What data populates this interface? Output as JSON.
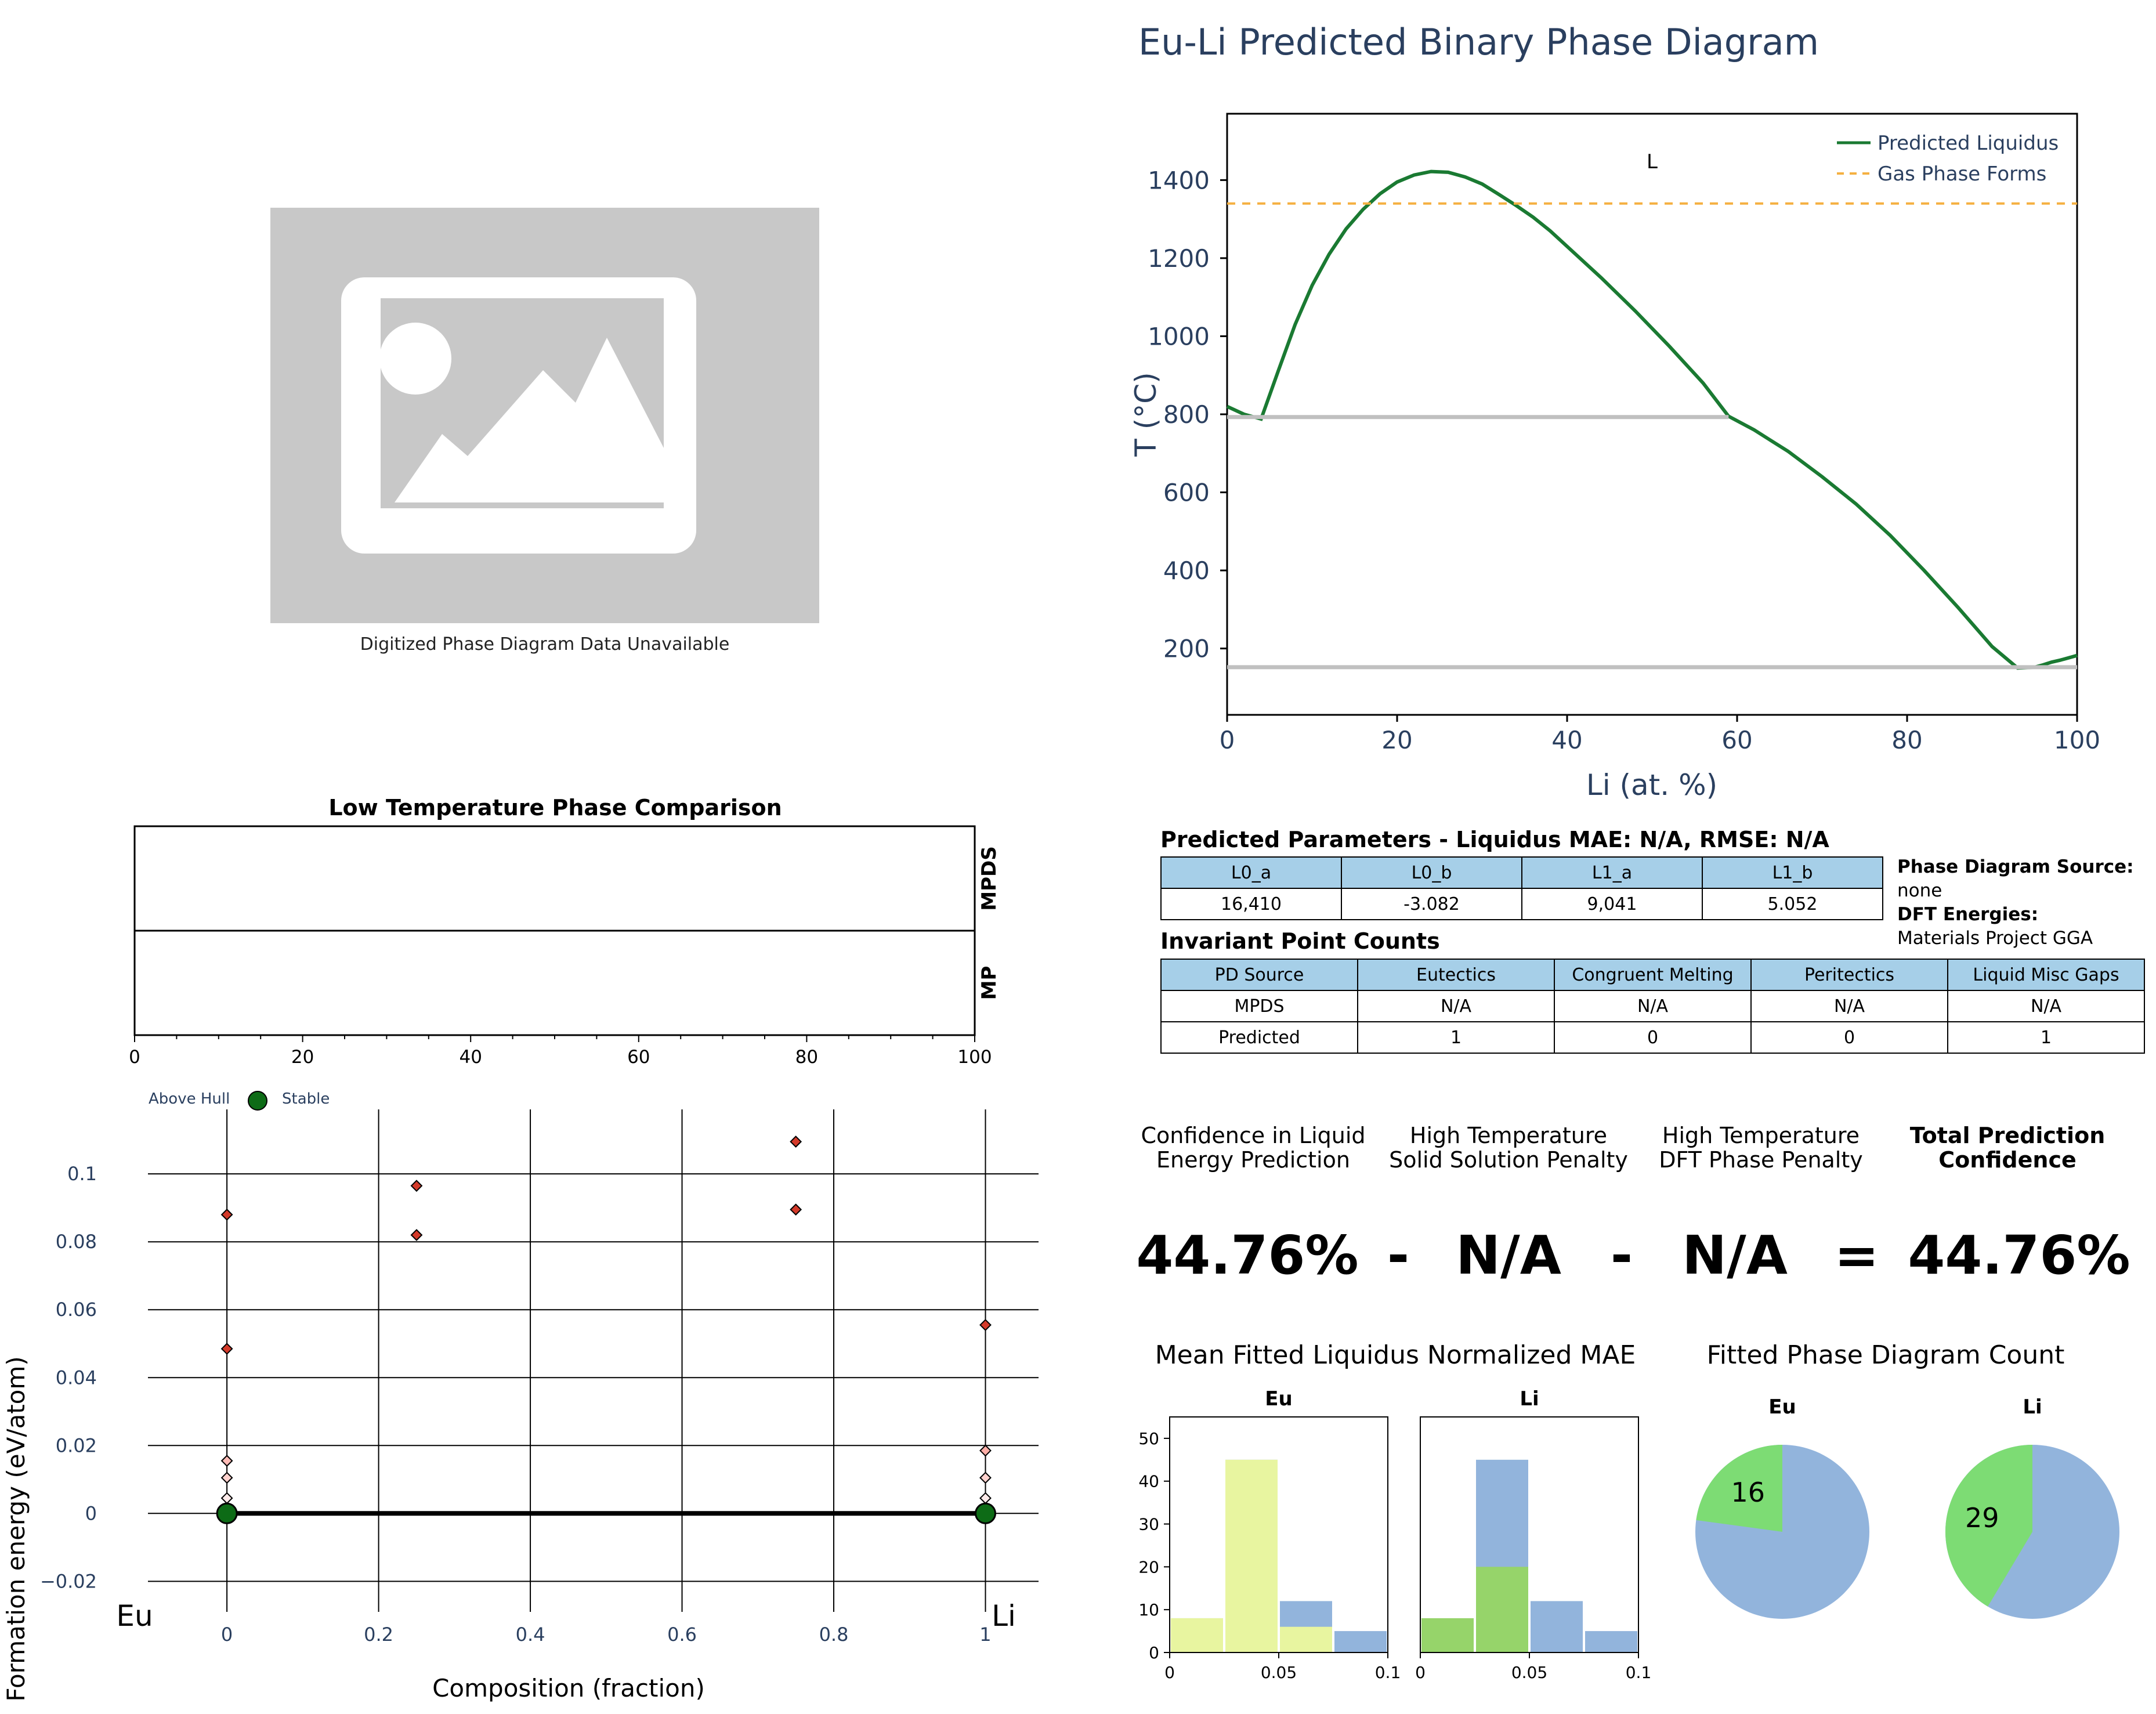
{
  "placeholder": {
    "caption": "Digitized Phase Diagram Data Unavailable",
    "icon": "image-placeholder-icon"
  },
  "phase_title": "Eu-Li Predicted Binary Phase Diagram",
  "low_temp": {
    "title": "Low Temperature Phase Comparison",
    "row_labels": [
      "MPDS",
      "MP"
    ],
    "x_ticks": [
      0,
      20,
      40,
      60,
      80,
      100
    ]
  },
  "params": {
    "title": "Predicted Parameters - Liquidus MAE: N/A, RMSE: N/A",
    "headers": [
      "L0_a",
      "L0_b",
      "L1_a",
      "L1_b"
    ],
    "values": [
      "16,410",
      "-3.082",
      "9,041",
      "5.052"
    ],
    "source_label": "Phase Diagram Source:",
    "source_value": "none",
    "dft_label": "DFT Energies:",
    "dft_value": "Materials Project GGA"
  },
  "invariants": {
    "title": "Invariant Point Counts",
    "headers": [
      "PD Source",
      "Eutectics",
      "Congruent Melting",
      "Peritectics",
      "Liquid Misc Gaps"
    ],
    "rows": [
      [
        "MPDS",
        "N/A",
        "N/A",
        "N/A",
        "N/A"
      ],
      [
        "Predicted",
        "1",
        "0",
        "0",
        "1"
      ]
    ]
  },
  "confidence": {
    "headers": [
      [
        "Confidence in Liquid",
        "Energy Prediction"
      ],
      [
        "High Temperature",
        "Solid Solution Penalty"
      ],
      [
        "High Temperature",
        "DFT Phase Penalty"
      ],
      [
        "Total Prediction",
        "Confidence"
      ]
    ],
    "values": [
      "44.76%",
      "N/A",
      "N/A",
      "44.76%"
    ],
    "operators": [
      "-",
      "-",
      "="
    ]
  },
  "colors": {
    "liquidus": "#1a7a32",
    "gas": "#f5b041",
    "invariant_line": "#c0c0c0",
    "stable": "#0d6b16",
    "above_hull": "#d43a2a",
    "hist_yellow": "#e8f5a0",
    "hist_blue": "#92b4dc",
    "hist_green": "#96d46a",
    "pie_green": "#7ddc74",
    "pie_blue": "#92b4dc",
    "header_blue": "#a6cfe8",
    "title_navy": "#2a3f5f"
  },
  "chart_data": [
    {
      "type": "line",
      "title": "Eu-Li Predicted Binary Phase Diagram",
      "xlabel": "Li (at. %)",
      "ylabel": "T (°C)",
      "xlim": [
        0,
        100
      ],
      "ylim": [
        30,
        1570
      ],
      "x_ticks": [
        0,
        20,
        40,
        60,
        80,
        100
      ],
      "y_ticks": [
        200,
        400,
        600,
        800,
        1000,
        1200,
        1400
      ],
      "legend_position": "top-right",
      "annotations": [
        {
          "text": "L",
          "x": 50,
          "y": 1430
        }
      ],
      "series": [
        {
          "name": "Predicted Liquidus",
          "style": "solid",
          "x": [
            0,
            2,
            4,
            6,
            8,
            10,
            12,
            14,
            16,
            18,
            20,
            22,
            24,
            26,
            28,
            30,
            32,
            34,
            36,
            38,
            40,
            44,
            48,
            52,
            56,
            59,
            62,
            66,
            70,
            74,
            78,
            82,
            86,
            90,
            93,
            95,
            96,
            97,
            98,
            100
          ],
          "y": [
            820,
            800,
            788,
            910,
            1030,
            1130,
            1210,
            1275,
            1325,
            1365,
            1395,
            1413,
            1422,
            1420,
            1408,
            1390,
            1363,
            1335,
            1305,
            1270,
            1230,
            1150,
            1065,
            975,
            880,
            795,
            760,
            705,
            640,
            570,
            490,
            400,
            305,
            205,
            150,
            152,
            158,
            165,
            170,
            182
          ]
        },
        {
          "name": "Gas Phase Forms",
          "style": "dashed",
          "x": [
            0,
            100
          ],
          "y": [
            1340,
            1340
          ]
        },
        {
          "name": "",
          "style": "invariant",
          "x": [
            0,
            59
          ],
          "y": [
            793,
            793
          ]
        },
        {
          "name": "",
          "style": "invariant",
          "x": [
            0,
            100
          ],
          "y": [
            152,
            152
          ]
        }
      ]
    },
    {
      "type": "scatter",
      "xlabel": "Composition (fraction)",
      "ylabel": "Formation energy (eV/atom)",
      "xlim": [
        -0.15,
        1.07
      ],
      "ylim": [
        -0.029,
        0.119
      ],
      "x_ticks": [
        0,
        0.2,
        0.4,
        0.6,
        0.8,
        1
      ],
      "x_tick_labels": [
        "0",
        "0.2",
        "0.4",
        "0.6",
        "0.8",
        "1"
      ],
      "y_ticks": [
        -0.02,
        0,
        0.02,
        0.04,
        0.06,
        0.08,
        0.1
      ],
      "y_tick_labels": [
        "−0.02",
        "0",
        "0.02",
        "0.04",
        "0.06",
        "0.08",
        "0.1"
      ],
      "end_labels": [
        "Eu",
        "Li"
      ],
      "legend": [
        "Above Hull",
        "Stable"
      ],
      "legend_position": "top-left",
      "hull_line": {
        "x": [
          0,
          1
        ],
        "y": [
          0,
          0
        ]
      },
      "stable_points": [
        {
          "x": 0,
          "y": 0
        },
        {
          "x": 1,
          "y": 0
        }
      ],
      "above_hull_points": [
        {
          "x": 0,
          "y": 0.088
        },
        {
          "x": 0,
          "y": 0.0485
        },
        {
          "x": 0,
          "y": 0.0155
        },
        {
          "x": 0,
          "y": 0.0105
        },
        {
          "x": 0,
          "y": 0.0045
        },
        {
          "x": 0.25,
          "y": 0.0965
        },
        {
          "x": 0.25,
          "y": 0.082
        },
        {
          "x": 0.75,
          "y": 0.1095
        },
        {
          "x": 0.75,
          "y": 0.0895
        },
        {
          "x": 1,
          "y": 0.0555
        },
        {
          "x": 1,
          "y": 0.0185
        },
        {
          "x": 1,
          "y": 0.0105
        },
        {
          "x": 1,
          "y": 0.0045
        },
        {
          "x": 1,
          "y": 0.0015
        }
      ]
    },
    {
      "type": "bar",
      "title": "Mean Fitted Liquidus Normalized MAE",
      "panels": [
        {
          "name": "Eu",
          "bins": [
            0,
            0.025,
            0.05,
            0.075,
            0.1
          ],
          "series": [
            {
              "name": "",
              "color": "#92b4dc",
              "values": [
                8,
                45,
                12,
                5
              ]
            },
            {
              "name": "",
              "color": "#e8f5a0",
              "values": [
                8,
                45,
                6,
                0
              ]
            }
          ]
        },
        {
          "name": "Li",
          "bins": [
            0,
            0.025,
            0.05,
            0.075,
            0.1
          ],
          "series": [
            {
              "name": "",
              "color": "#92b4dc",
              "values": [
                8,
                45,
                12,
                5
              ]
            },
            {
              "name": "",
              "color": "#96d46a",
              "values": [
                8,
                20,
                0,
                0
              ]
            }
          ]
        }
      ],
      "ylim": [
        0,
        55
      ],
      "y_ticks": [
        0,
        10,
        20,
        30,
        40,
        50
      ],
      "x_ticks": [
        0,
        0.05,
        0.1
      ],
      "x_tick_labels": [
        "0",
        "0.05",
        "0.1"
      ]
    },
    {
      "type": "pie",
      "title": "Fitted Phase Diagram Count",
      "total": 70,
      "panels": [
        {
          "name": "Eu",
          "highlight": 16,
          "label": "16"
        },
        {
          "name": "Li",
          "highlight": 29,
          "label": "29"
        }
      ]
    }
  ]
}
